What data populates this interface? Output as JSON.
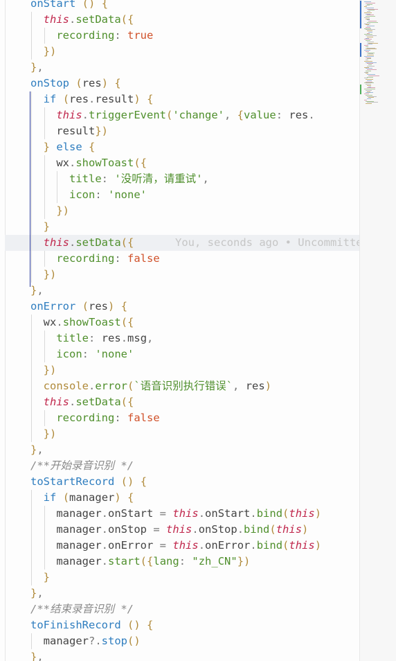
{
  "editor": {
    "lines": [
      "onStart () {",
      "  this.setData({",
      "    recording: true",
      "  })",
      "},",
      "onStop (res) {",
      "  if (res.result) {",
      "    this.triggerEvent('change', {value: res.",
      "    result})",
      "  } else {",
      "    wx.showToast({",
      "      title: '没听清，请重试',",
      "      icon: 'none'",
      "    })",
      "  }",
      "  this.setData({",
      "    recording: false",
      "  })",
      "},",
      "onError (res) {",
      "  wx.showToast({",
      "    title: res.msg,",
      "    icon: 'none'",
      "  })",
      "  console.error(`语音识别执行错误`, res)",
      "  this.setData({",
      "    recording: false",
      "  })",
      "},",
      "/**开始录音识别 */",
      "toStartRecord () {",
      "  if (manager) {",
      "    manager.onStart = this.onStart.bind(this)",
      "    manager.onStop = this.onStop.bind(this)",
      "    manager.onError = this.onError.bind(this)",
      "    manager.start({lang: \"zh_CN\"})",
      "  }",
      "},",
      "/**结束录音识别 */",
      "toFinishRecord () {",
      "  manager?.stop()",
      "},"
    ],
    "current_line_index": 15,
    "blame_annotation": "You, seconds ago • Uncommitte"
  },
  "colors": {
    "background": "#fdfdfd",
    "function_name": "#2e7dbf",
    "this_keyword": "#c0264b",
    "string": "#4f8f2c",
    "boolean": "#d0512a",
    "comment": "#8a8a8a",
    "current_line": "#eef0f3",
    "bracket_match": "#2a3a9a"
  }
}
